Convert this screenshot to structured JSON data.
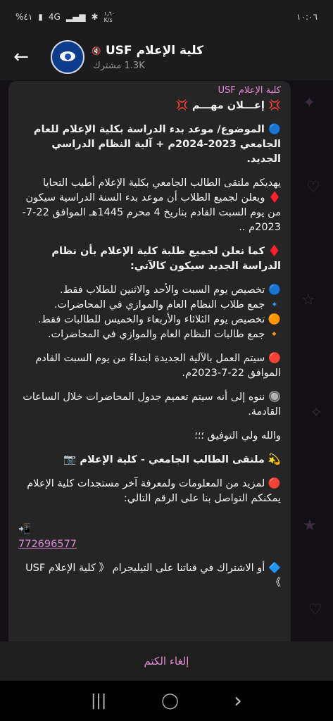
{
  "status_bar": {
    "time": "١٠:٠٦",
    "speed": "١٫٦٠\nK/s",
    "network": "4G",
    "battery": "%٤١"
  },
  "header": {
    "back_icon": "arrow-left-icon",
    "channel_name": "كلية الإعلام USF",
    "subscribers": "1.3K مشترك"
  },
  "message": {
    "sender": "كلية الإعلام USF",
    "paragraphs": [
      "💢 إعـــلان مهـــم 💢",
      "🔵 الموضوع/ موعد بدء الدراسة بكلية الإعلام للعام الجامعي 2023-2024م + آلية النظام الدراسي الجديد.",
      "يهديكم ملتقى الطالب الجامعي بكلية الإعلام أطيب التحايا\n♦️ ويعلن لجميع الطلاب أن موعد بدء السنة الدراسية سيكون من يوم السبت القادم بتاريخ 4 محرم 1445هـ الموافق 22-7-2023م ..",
      "♦️ كما نعلن لجميع طلبة كلية الإعلام بأن نظام الدراسة الجديد سيكون كالآتي:",
      "🔵 تخصيص يوم السبت والأحد والاثنين للطلاب فقط.\n🔹 جمع طلاب النظام العام والموازي في المحاضرات.\n🟠 تخصيص يوم الثلاثاء والأربعاء والخميس للطالبات فقط.\n🔸 جمع طالبات النظام العام والموازي في المحاضرات.",
      "🔴 سيتم العمل بالآلية الجديدة ابتداءً من يوم السبت القادم الموافق 22-7-2023م.",
      "🔘 ننوه إلى أنه سيتم تعميم جدول المحاضرات خلال الساعات القادمة.",
      "والله ولي التوفيق ؛؛؛",
      "💫 ملتقى الطالب الجامعي - كلية الإعلام 📷",
      "🔴 لمزيد من المعلومات ولمعرفة آخر مستجدات كلية الإعلام يمكنكم التواصل بنا على الرقم التالي:",
      "🔷 أو الاشتراك في قناتنا على التيليجرام 《 كلية الإعلام USF 》"
    ],
    "phone": "772696577",
    "phone_icon": "📲"
  },
  "mute_button": "إلغاء الكتم",
  "nav": {
    "recents": "|||",
    "home": "◯",
    "back": "›"
  }
}
